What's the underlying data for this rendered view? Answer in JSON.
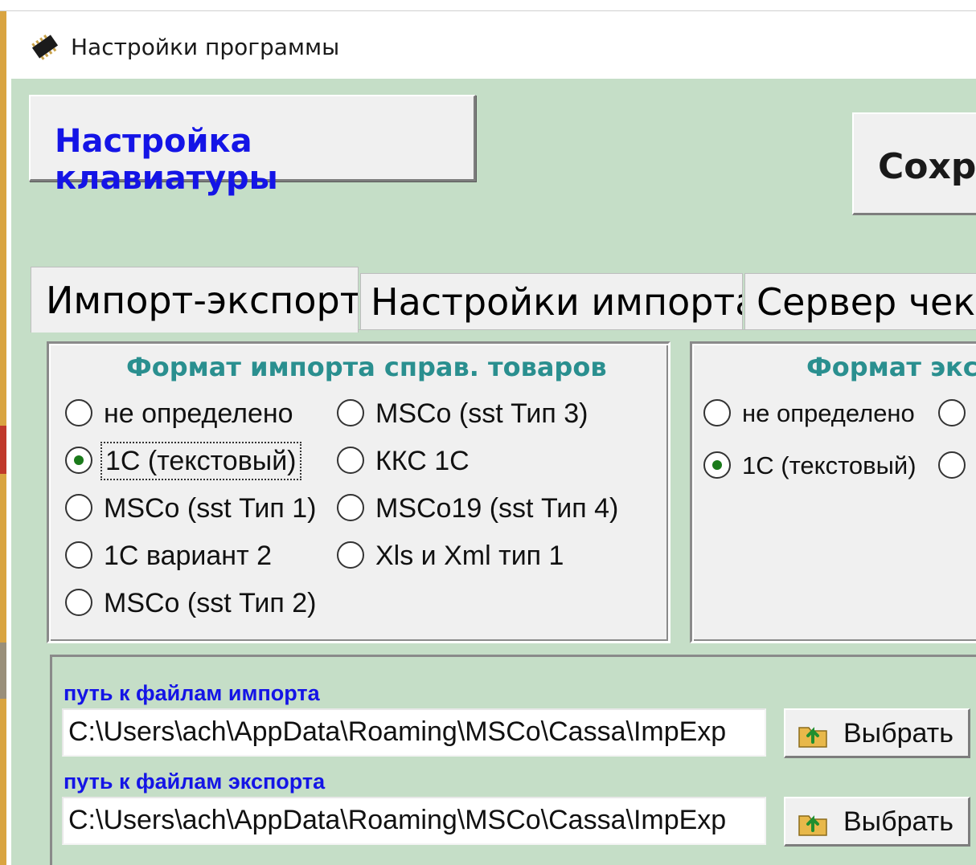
{
  "window": {
    "title": "Настройки программы",
    "icon": "chip-icon"
  },
  "toolbar": {
    "keyboard_button": "Настройка клавиатуры",
    "save_button": "Сохр"
  },
  "tabs": [
    {
      "label": "Импорт-экспорт",
      "active": true
    },
    {
      "label": "Настройки импорта",
      "active": false
    },
    {
      "label": "Сервер чек",
      "active": false
    }
  ],
  "import_format": {
    "title": "Формат импорта справ. товаров",
    "options": [
      {
        "label": "не определено",
        "checked": false
      },
      {
        "label": "1С (текстовый)",
        "checked": true
      },
      {
        "label": "MSCo (sst Тип 1)",
        "checked": false
      },
      {
        "label": "1С вариант 2",
        "checked": false
      },
      {
        "label": "MSCo (sst Тип 2)",
        "checked": false
      },
      {
        "label": "MSCo (sst Тип 3)",
        "checked": false
      },
      {
        "label": "ККС 1С",
        "checked": false
      },
      {
        "label": "MSCo19 (sst Тип 4)",
        "checked": false
      },
      {
        "label": "Xls и Xml тип 1",
        "checked": false
      }
    ]
  },
  "export_format": {
    "title": "Формат экс",
    "options": [
      {
        "label": "не определено",
        "checked": false
      },
      {
        "label": "1С (текстовый)",
        "checked": true
      }
    ]
  },
  "paths": {
    "import_label": "путь к файлам импорта",
    "import_value": "C:\\Users\\ach\\AppData\\Roaming\\MSCo\\Cassa\\ImpExp",
    "export_label": "путь к файлам экспорта",
    "export_value": "C:\\Users\\ach\\AppData\\Roaming\\MSCo\\Cassa\\ImpExp",
    "pick_label": "Выбрать"
  },
  "colors": {
    "background": "#c5dec7",
    "accent_blue": "#1414e6",
    "group_title": "#2a8f8f"
  }
}
